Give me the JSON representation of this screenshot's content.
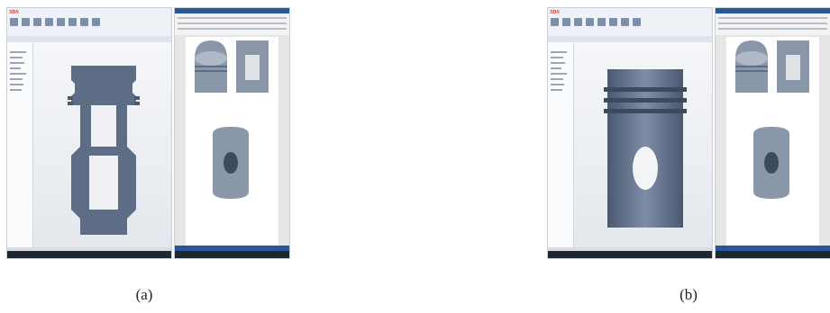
{
  "panels": [
    {
      "id": "a",
      "caption": "(a)",
      "view": "section"
    },
    {
      "id": "b",
      "caption": "(b)",
      "view": "exterior"
    }
  ],
  "colors": {
    "model": "#5d6d86",
    "ribbon": "#2b579a",
    "taskbar": "#1f2733"
  },
  "icons": [
    "solidworks-logo",
    "word-logo",
    "windows-taskbar"
  ]
}
